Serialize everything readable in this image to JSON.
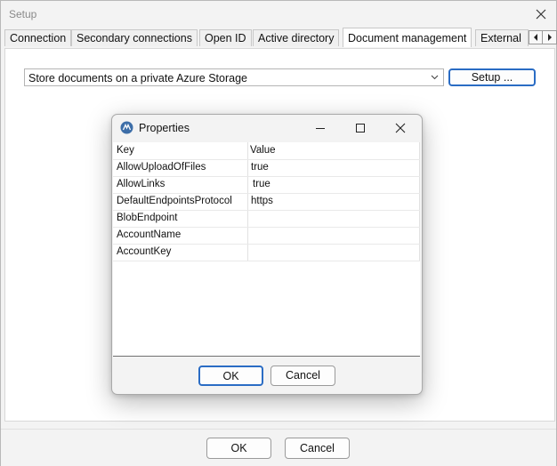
{
  "window": {
    "title": "Setup"
  },
  "tabs": [
    {
      "label": "Connection"
    },
    {
      "label": "Secondary connections"
    },
    {
      "label": "Open ID"
    },
    {
      "label": "Active directory"
    },
    {
      "label": "Document management"
    },
    {
      "label": "External"
    }
  ],
  "storage": {
    "selected": "Store documents on a private Azure Storage",
    "setup_label": "Setup ..."
  },
  "footer": {
    "ok_label": "OK",
    "cancel_label": "Cancel"
  },
  "dialog": {
    "title": "Properties",
    "header_key": "Key",
    "header_value": "Value",
    "rows": [
      {
        "key": "AllowUploadOfFiles",
        "value": "true"
      },
      {
        "key": "AllowLinks",
        "value": "true"
      },
      {
        "key": "DefaultEndpointsProtocol",
        "value": "https"
      },
      {
        "key": "BlobEndpoint",
        "value": ""
      },
      {
        "key": "AccountName",
        "value": ""
      },
      {
        "key": "AccountKey",
        "value": ""
      }
    ],
    "ok_label": "OK",
    "cancel_label": "Cancel"
  },
  "colors": {
    "accent": "#2a6cc4"
  }
}
